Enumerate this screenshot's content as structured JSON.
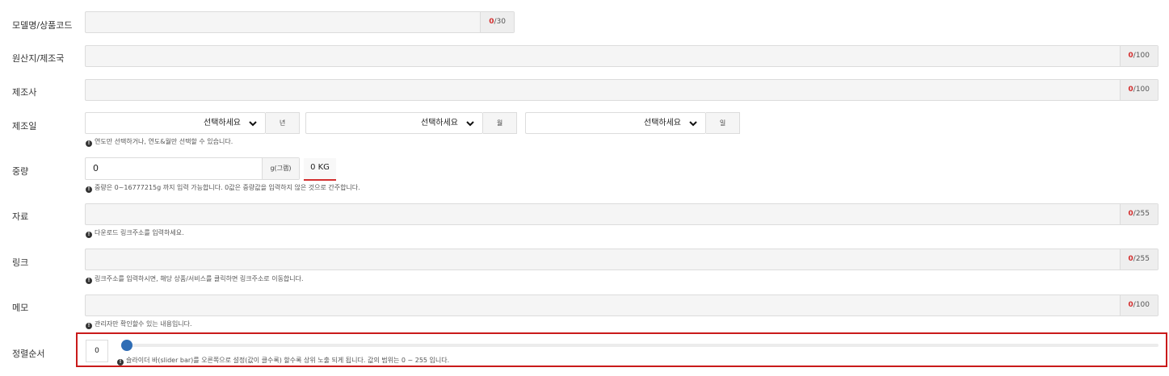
{
  "fields": {
    "model": {
      "label": "모델명/상품코드",
      "count": "0",
      "max": "/30"
    },
    "origin": {
      "label": "원산지/제조국",
      "count": "0",
      "max": "/100"
    },
    "maker": {
      "label": "제조사",
      "count": "0",
      "max": "/100"
    },
    "mfg_date": {
      "label": "제조일",
      "year_select": "선택하세요",
      "year_unit": "년",
      "month_select": "선택하세요",
      "month_unit": "월",
      "day_select": "선택하세요",
      "day_unit": "일",
      "help": "연도만 선택하거나, 연도&월만 선택할 수 있습니다."
    },
    "weight": {
      "label": "중량",
      "value": "0",
      "unit": "g(그램)",
      "kg_display": "0 KG",
      "help": "중량은 0~16777215g 까지 입력 가능합니다. 0값은 중량값을 입력하지 않은 것으로 간주합니다."
    },
    "data": {
      "label": "자료",
      "count": "0",
      "max": "/255",
      "help": "다운로드 링크주소를 입력하세요."
    },
    "link": {
      "label": "링크",
      "count": "0",
      "max": "/255",
      "help": "링크주소를 입력하시면, 해당 상품/서비스를 클릭하면 링크주소로 이동합니다."
    },
    "memo": {
      "label": "메모",
      "count": "0",
      "max": "/100",
      "help": "관리자만 확인할수 있는 내용입니다."
    },
    "sort_order": {
      "label": "정렬순서",
      "value": "0",
      "slider_level": 0,
      "help": "슬라이더 바(slider bar)를 오른쪽으로 설정(값이 클수록) 할수록 상위 노출 되게 됩니다. 값의 범위는 0 ~ 255 입니다."
    }
  },
  "icons": {
    "info": "info-icon",
    "dropdown": "chevron-down-icon"
  },
  "colors": {
    "counter_current": "#d32f2f",
    "highlight_border": "#c91a1a",
    "slider_thumb": "#2f6db5"
  }
}
